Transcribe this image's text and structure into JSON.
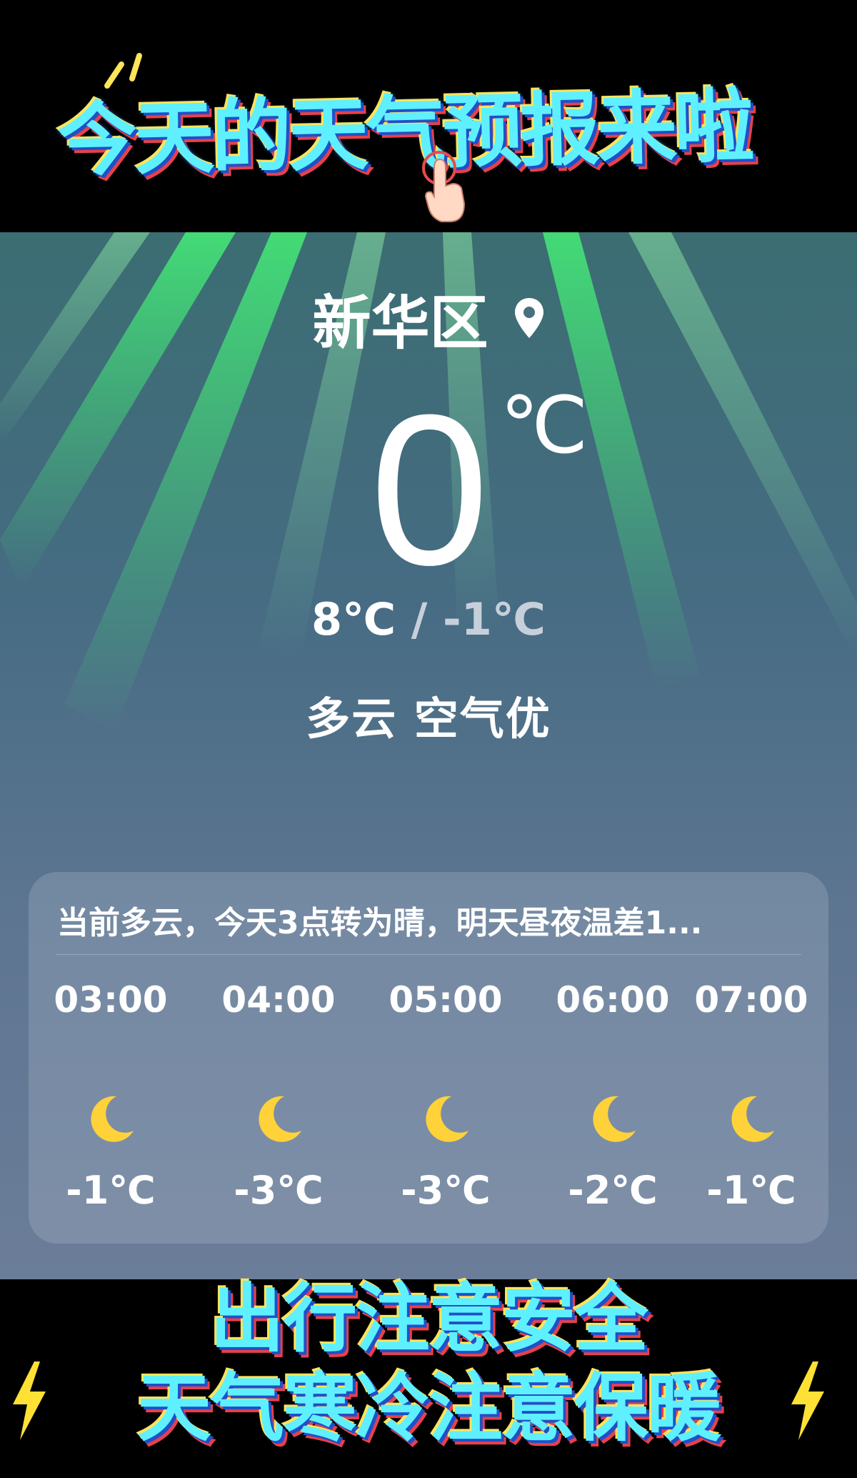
{
  "top_banner": {
    "title": "今天的天气预报来啦"
  },
  "location": {
    "name": "新华区",
    "icon": "location-pin-icon"
  },
  "current": {
    "temperature": "0",
    "unit": "℃",
    "high": "8℃",
    "separator": "/",
    "low": "-1℃",
    "condition": "多云",
    "air_quality": "空气优"
  },
  "forecast": {
    "summary": "当前多云，今天3点转为晴，明天昼夜温差1...",
    "hours": [
      {
        "time": "03:00",
        "icon": "moon-icon",
        "temp": "-1℃"
      },
      {
        "time": "04:00",
        "icon": "moon-icon",
        "temp": "-3℃"
      },
      {
        "time": "05:00",
        "icon": "moon-icon",
        "temp": "-3℃"
      },
      {
        "time": "06:00",
        "icon": "moon-icon",
        "temp": "-2℃"
      },
      {
        "time": "07:00",
        "icon": "moon-icon",
        "temp": "-1℃"
      }
    ]
  },
  "bottom_banner": {
    "line1": "出行注意安全",
    "line2": "天气寒冷注意保暖"
  },
  "colors": {
    "banner_text": "#5ff0ff",
    "moon": "#ffd23a",
    "ray": "#3cff6a"
  }
}
